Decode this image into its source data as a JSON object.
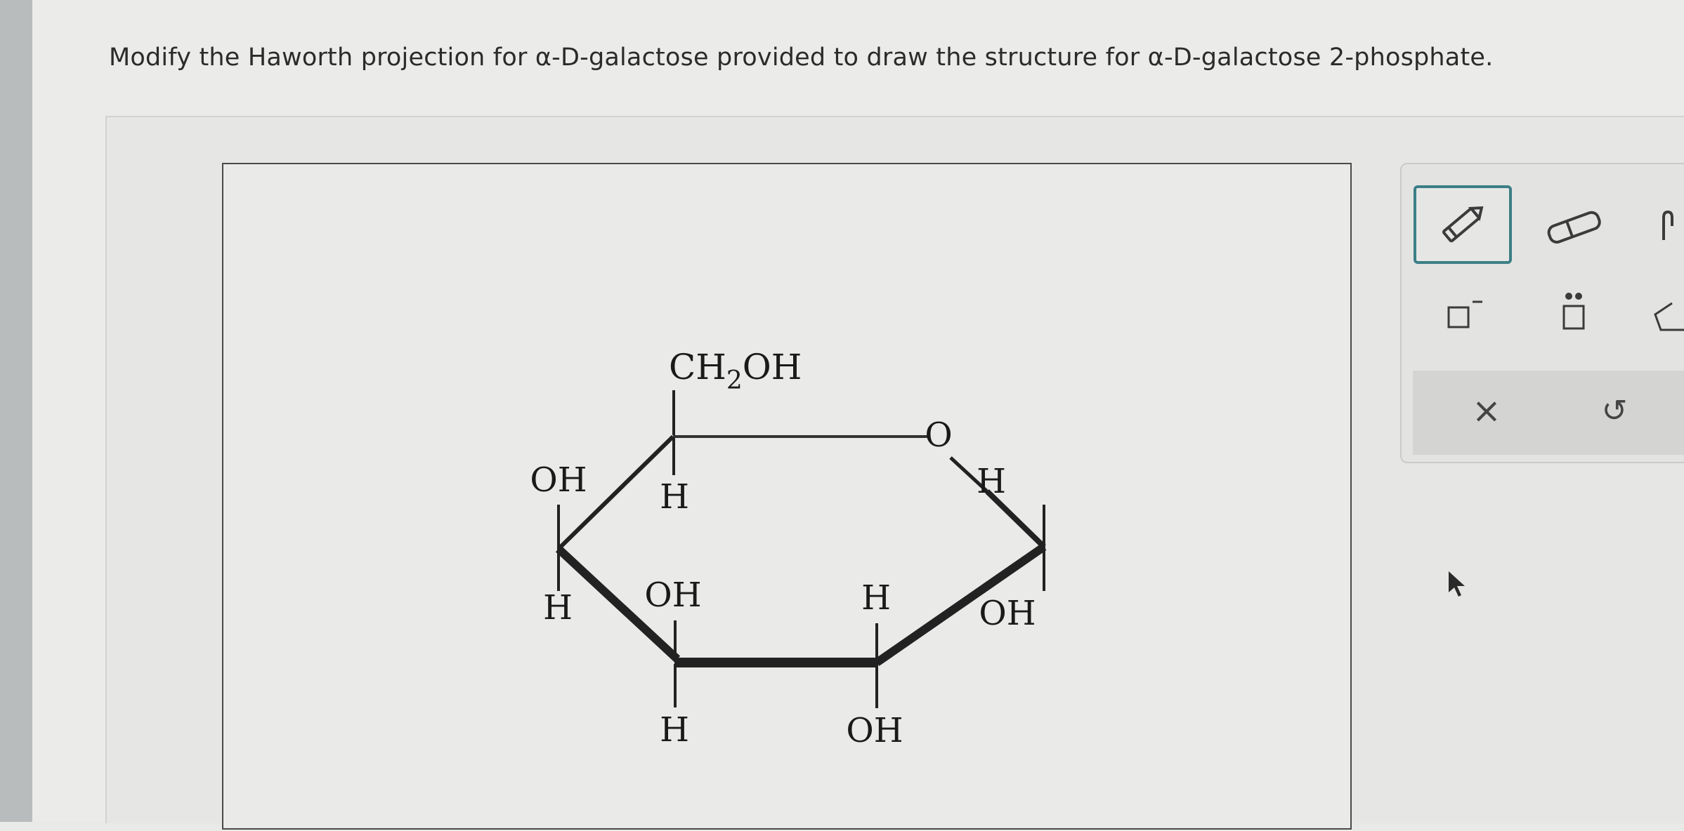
{
  "question": {
    "text": "Modify the Haworth projection for α-D-galactose provided to draw the structure for α-D-galactose 2-phosphate."
  },
  "molecule": {
    "c6_group": "CH",
    "c6_subscript": "2",
    "c6_oh": "OH",
    "ring_oxygen": "O",
    "c4_top": "OH",
    "c4_bottom": "H",
    "c5_bottom": "H",
    "c3_top": "OH",
    "c3_bottom": "H",
    "c2_top": "H",
    "c2_bottom": "OH",
    "c1_top": "H",
    "c1_bottom": "OH"
  },
  "toolbar": {
    "tools": [
      {
        "name": "pencil",
        "icon": "pencil-icon",
        "selected": true
      },
      {
        "name": "eraser",
        "icon": "eraser-icon",
        "selected": false
      },
      {
        "name": "hand",
        "icon": "hand-icon",
        "selected": false
      },
      {
        "name": "negative-charge",
        "icon": "negative-charge-icon",
        "selected": false
      },
      {
        "name": "lone-pair",
        "icon": "lone-pair-icon",
        "selected": false
      },
      {
        "name": "ring",
        "icon": "ring-icon",
        "selected": false
      }
    ],
    "clear_label": "×",
    "undo_label": "↺"
  },
  "colors": {
    "selected_border": "#3b7f86",
    "canvas_border": "#4a4a4a"
  }
}
